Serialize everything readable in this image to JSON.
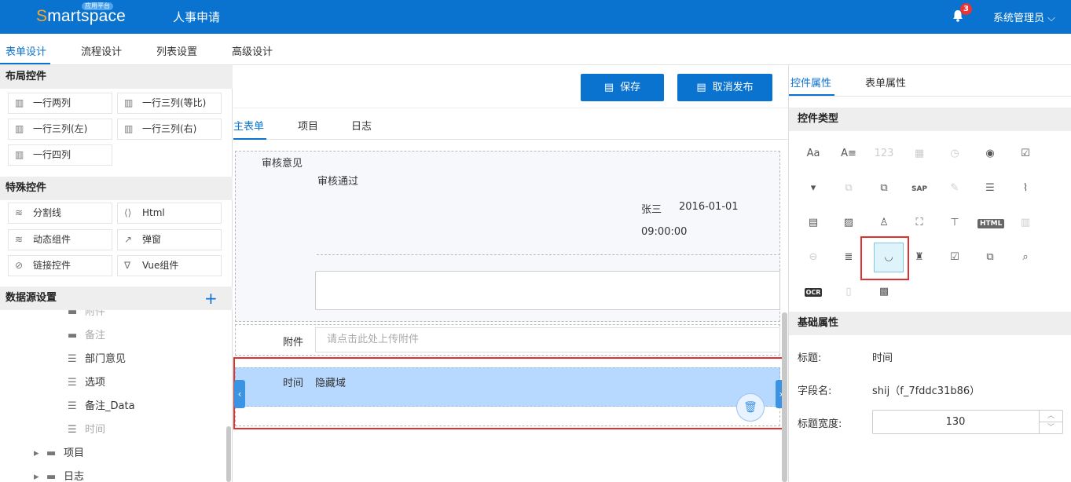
{
  "header": {
    "logo_prefix": "S",
    "logo_rest": "martspace",
    "logo_badge": "应用平台",
    "app_title": "人事申请",
    "notification_count": "3",
    "user_name": "系统管理员"
  },
  "main_tabs": [
    "表单设计",
    "流程设计",
    "列表设置",
    "高级设计"
  ],
  "left": {
    "layout_title": "布局控件",
    "layout_items": [
      "一行两列",
      "一行三列(等比)",
      "一行三列(左)",
      "一行三列(右)",
      "一行四列"
    ],
    "special_title": "特殊控件",
    "special_items": [
      "分割线",
      "Html",
      "动态组件",
      "弹窗",
      "链接控件",
      "Vue组件"
    ],
    "datasource_title": "数据源设置",
    "datasource_add": "+",
    "tree": [
      "附件",
      "备注",
      "部门意见",
      "选项",
      "备注_Data",
      "时间",
      "项目",
      "日志"
    ]
  },
  "toolbar": {
    "save_label": "保存",
    "unpublish_label": "取消发布"
  },
  "form_tabs": [
    "主表单",
    "项目",
    "日志"
  ],
  "form": {
    "audit_label": "审核意见",
    "audit_value": "审核通过",
    "audit_user": "张三",
    "audit_date": "2016-01-01",
    "audit_time": "09:00:00",
    "attach_label": "附件",
    "attach_placeholder": "请点击此处上传附件",
    "time_label": "时间",
    "time_value": "隐藏域"
  },
  "right": {
    "tabs": [
      "控件属性",
      "表单属性"
    ],
    "type_title": "控件类型",
    "basic_title": "基础属性",
    "props": {
      "title_label": "标题:",
      "title_value": "时间",
      "field_label": "字段名:",
      "field_value": "shij（f_7fddc31b86）",
      "width_label": "标题宽度:",
      "width_value": "130"
    }
  }
}
